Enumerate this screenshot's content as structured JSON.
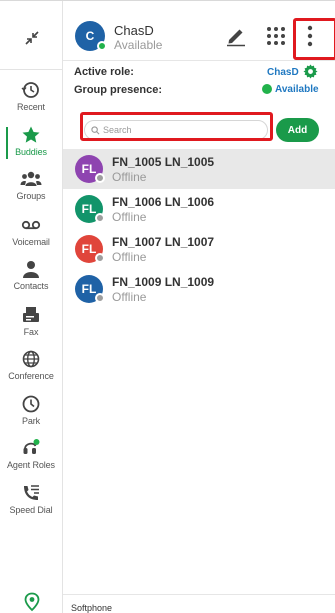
{
  "rail": {
    "items": [
      {
        "label": "Recent",
        "icon": "history-icon"
      },
      {
        "label": "Buddies",
        "icon": "star-icon",
        "active": true
      },
      {
        "label": "Groups",
        "icon": "groups-icon"
      },
      {
        "label": "Voicemail",
        "icon": "voicemail-icon"
      },
      {
        "label": "Contacts",
        "icon": "contact-icon"
      },
      {
        "label": "Fax",
        "icon": "fax-icon"
      },
      {
        "label": "Conference",
        "icon": "globe-icon"
      },
      {
        "label": "Park",
        "icon": "clock-icon"
      },
      {
        "label": "Agent Roles",
        "icon": "agent-headset-icon"
      },
      {
        "label": "Speed Dial",
        "icon": "speed-dial-icon"
      }
    ],
    "collapse_icon": "collapse-arrows-icon",
    "location_icon": "location-pin-icon"
  },
  "header": {
    "avatar_initial": "C",
    "user_name": "ChasD",
    "user_status": "Available",
    "edit_icon": "pencil-icon",
    "dialpad_icon": "dialpad-icon",
    "more_icon": "more-vertical-icon"
  },
  "role": {
    "active_role_label": "Active role:",
    "active_role_value": "ChasD",
    "group_presence_label": "Group presence:",
    "group_presence_value": "Available"
  },
  "search": {
    "placeholder": "Search",
    "add_label": "Add"
  },
  "buddies": [
    {
      "initials": "FL",
      "name": "FN_1005 LN_1005",
      "status": "Offline"
    },
    {
      "initials": "FL",
      "name": "FN_1006 LN_1006",
      "status": "Offline"
    },
    {
      "initials": "FL",
      "name": "FN_1007 LN_1007",
      "status": "Offline"
    },
    {
      "initials": "FL",
      "name": "FN_1009 LN_1009",
      "status": "Offline"
    }
  ],
  "footer": {
    "text": "Softphone"
  },
  "colors": {
    "accent_green": "#1a9a4a",
    "presence_available": "#21b24b",
    "presence_offline": "#9e9e9e",
    "link_blue": "#1f78c1",
    "highlight_red": "#e0191f",
    "avatar_colors": [
      "#8e44b0",
      "#12946a",
      "#e0453b",
      "#1f62a6"
    ]
  }
}
